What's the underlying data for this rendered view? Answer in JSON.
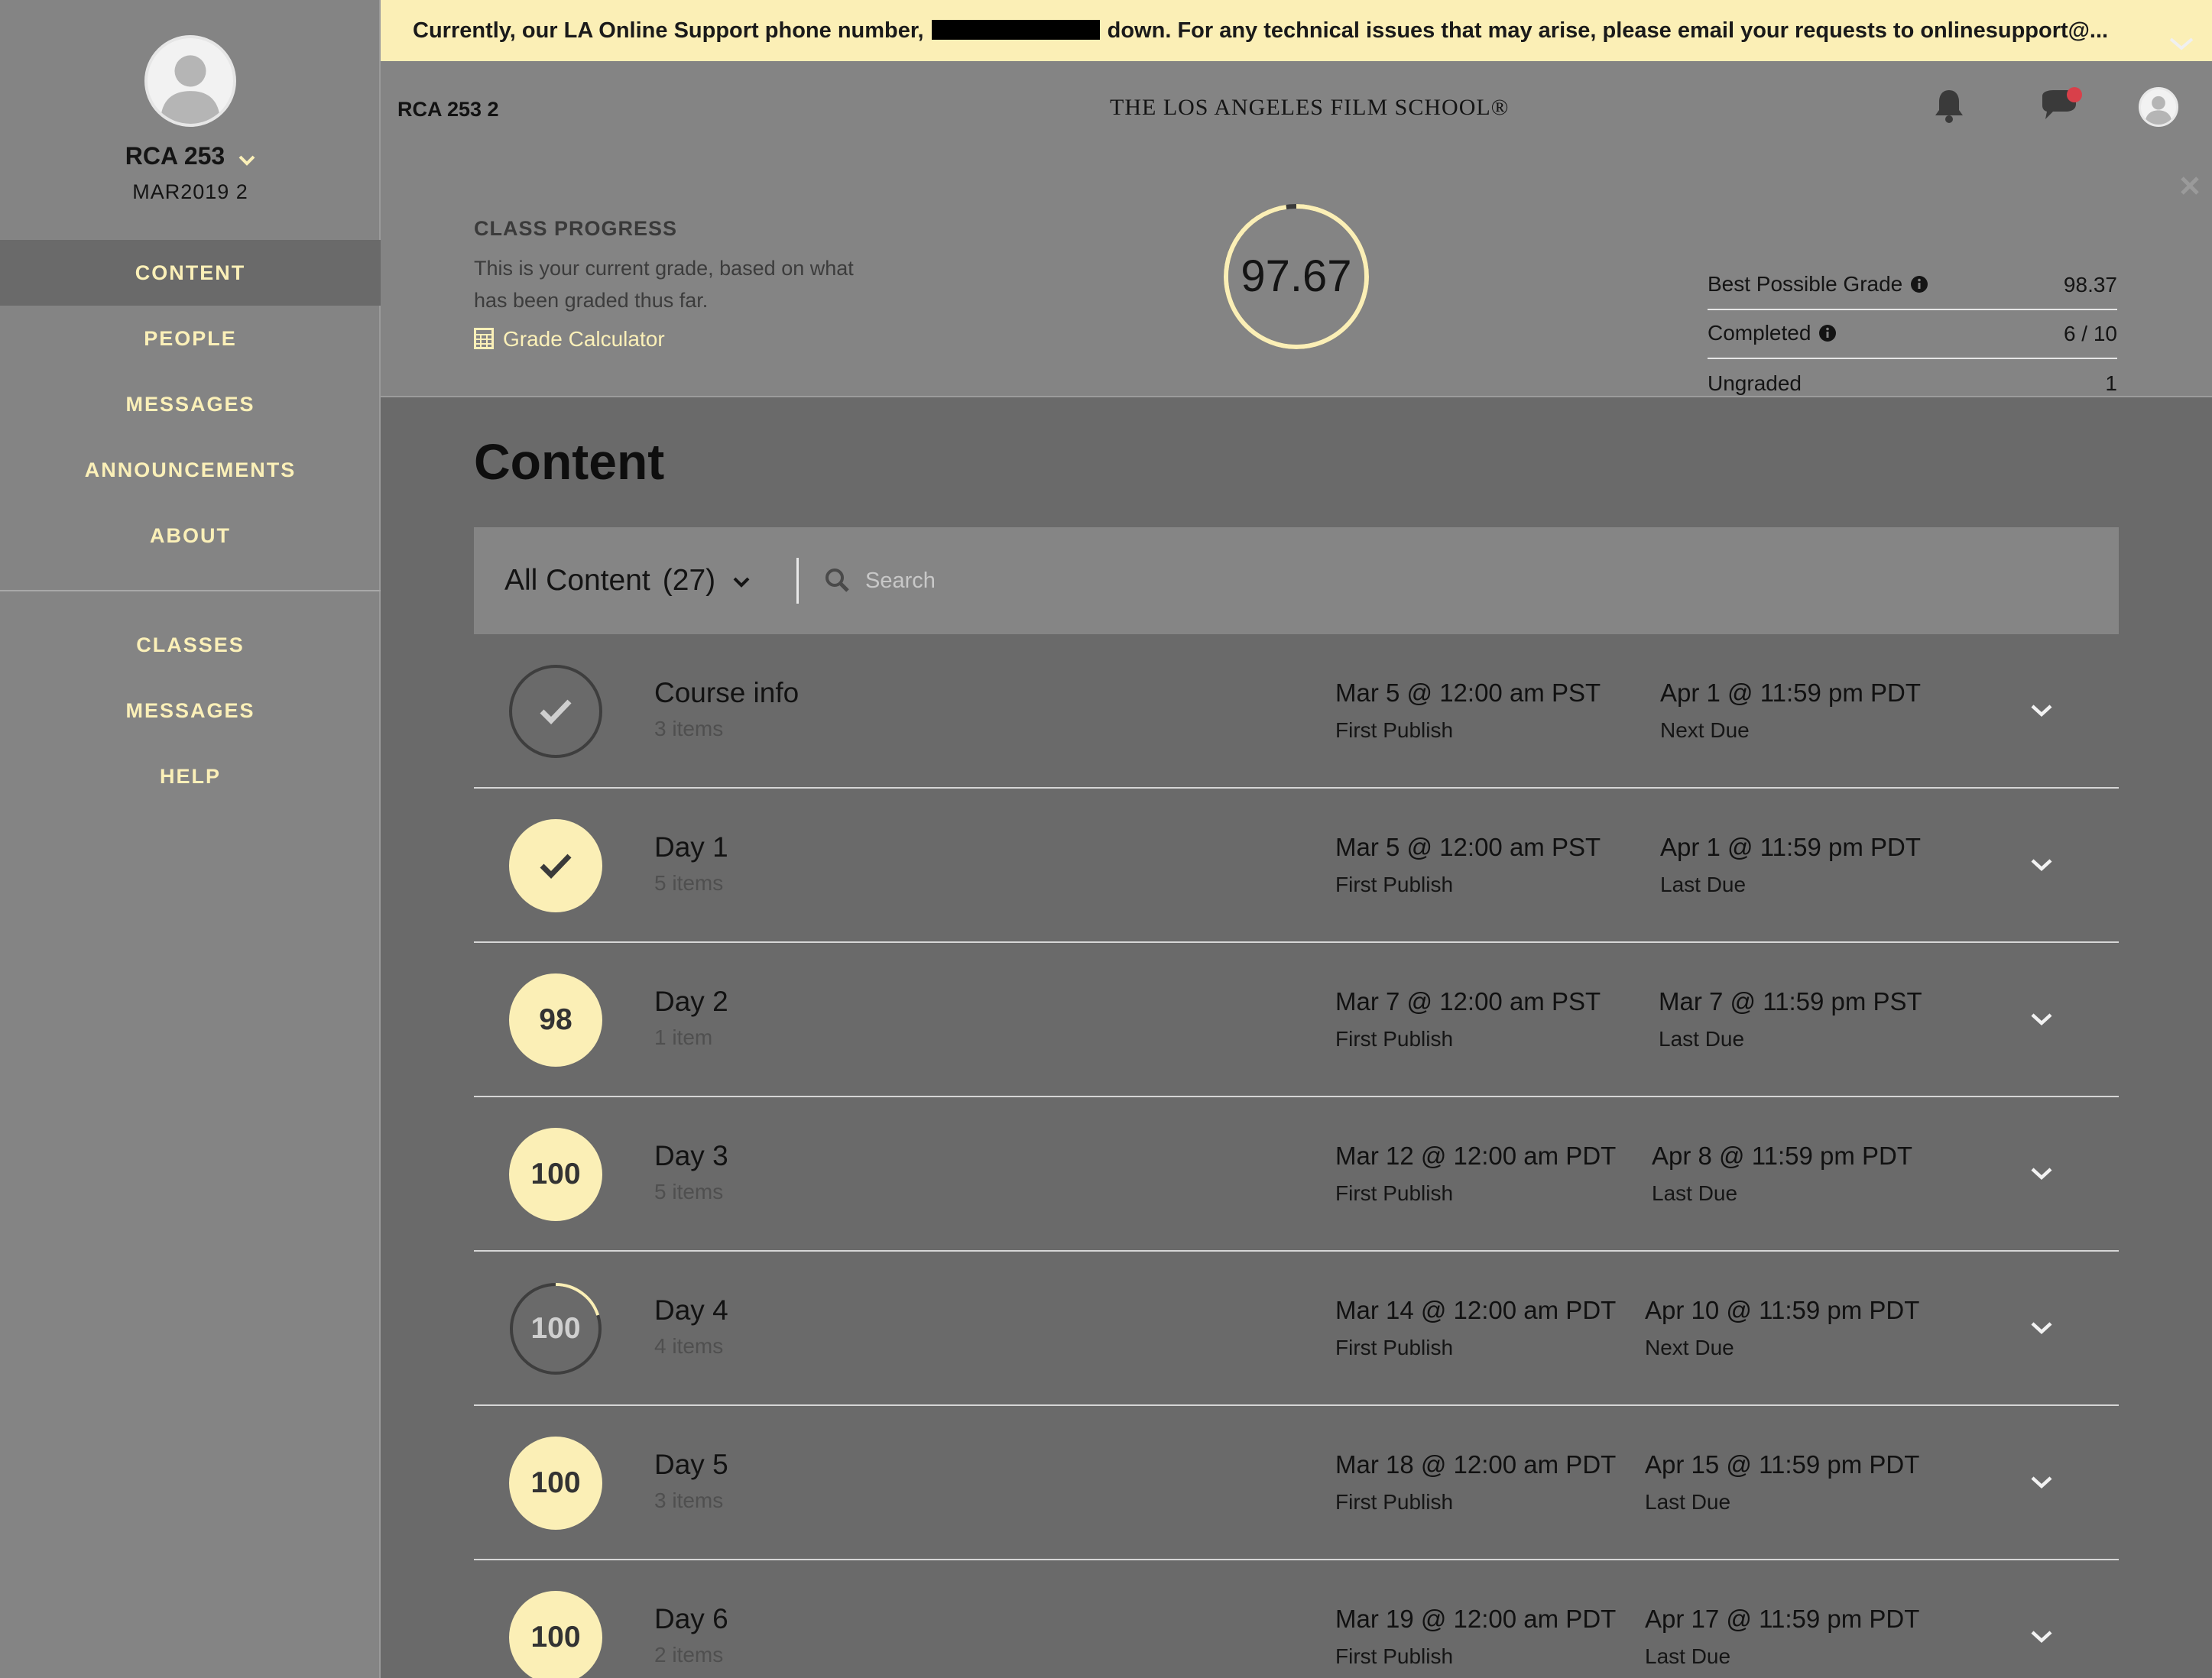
{
  "banner": {
    "text_before": "Currently, our LA Online Support phone number,",
    "text_after": "down. For any technical issues that may arise, please email your requests to onlinesupport@..."
  },
  "sidebar": {
    "course_name": "RCA 253",
    "course_term": "MAR2019 2",
    "nav_primary": [
      {
        "label": "CONTENT",
        "active": true
      },
      {
        "label": "PEOPLE"
      },
      {
        "label": "MESSAGES"
      },
      {
        "label": "ANNOUNCEMENTS"
      },
      {
        "label": "ABOUT"
      }
    ],
    "nav_secondary": [
      {
        "label": "CLASSES"
      },
      {
        "label": "MESSAGES"
      },
      {
        "label": "HELP"
      }
    ]
  },
  "header": {
    "class_code": "RCA 253 2",
    "school_name": "THE LOS ANGELES FILM SCHOOL®",
    "icons": [
      "bell-icon",
      "chat-icon",
      "user-avatar"
    ]
  },
  "progress": {
    "title": "CLASS PROGRESS",
    "description": "This is your current grade, based on what has been graded thus far.",
    "calculator_label": "Grade Calculator",
    "grade": "97.67",
    "grade_fraction": 0.9767,
    "stats": [
      {
        "label": "Best Possible Grade",
        "value": "98.37",
        "info": true
      },
      {
        "label": "Completed",
        "value": "6 / 10",
        "info": true
      },
      {
        "label": "Ungraded",
        "value": "1",
        "info": false
      }
    ]
  },
  "content": {
    "title": "Content",
    "filter_label": "All Content",
    "filter_count": "(27)",
    "search_placeholder": "Search",
    "items": [
      {
        "title": "Course info",
        "count": "3 items",
        "badge": "check-outline",
        "badge_text": "",
        "publish": "Mar 5 @ 12:00 am PST",
        "publish_label": "First Publish",
        "due": "Apr 1 @ 11:59 pm PDT",
        "due_label": "Next Due"
      },
      {
        "title": "Day 1",
        "count": "5 items",
        "badge": "check-filled",
        "badge_text": "",
        "publish": "Mar 5 @ 12:00 am PST",
        "publish_label": "First Publish",
        "due": "Apr 1 @ 11:59 pm PDT",
        "due_label": "Last Due"
      },
      {
        "title": "Day 2",
        "count": "1 item",
        "badge": "filled",
        "badge_text": "98",
        "publish": "Mar 7 @ 12:00 am PST",
        "publish_label": "First Publish",
        "due": "Mar 7 @ 11:59 pm PST",
        "due_label": "Last Due"
      },
      {
        "title": "Day 3",
        "count": "5 items",
        "badge": "filled",
        "badge_text": "100",
        "publish": "Mar 12 @ 12:00 am PDT",
        "publish_label": "First Publish",
        "due": "Apr 8 @ 11:59 pm PDT",
        "due_label": "Last Due"
      },
      {
        "title": "Day 4",
        "count": "4 items",
        "badge": "partial",
        "badge_text": "100",
        "progress": 0.2,
        "publish": "Mar 14 @ 12:00 am PDT",
        "publish_label": "First Publish",
        "due": "Apr 10 @ 11:59 pm PDT",
        "due_label": "Next Due"
      },
      {
        "title": "Day 5",
        "count": "3 items",
        "badge": "filled",
        "badge_text": "100",
        "publish": "Mar 18 @ 12:00 am PDT",
        "publish_label": "First Publish",
        "due": "Apr 15 @ 11:59 pm PDT",
        "due_label": "Last Due"
      },
      {
        "title": "Day 6",
        "count": "2 items",
        "badge": "filled",
        "badge_text": "100",
        "publish": "Mar 19 @ 12:00 am PDT",
        "publish_label": "First Publish",
        "due": "Apr 17 @ 11:59 pm PDT",
        "due_label": "Last Due"
      }
    ]
  },
  "colors": {
    "accent": "#fbefb6",
    "sidebar_bg": "#848484",
    "main_bg": "#6a6a6a",
    "notification_dot": "#d8404a"
  }
}
